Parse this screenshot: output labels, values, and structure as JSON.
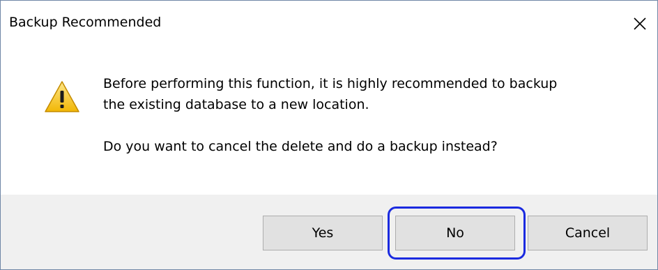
{
  "dialog": {
    "title": "Backup Recommended",
    "close_icon": "close-icon",
    "warning_icon": "warning-icon",
    "message_line1": "Before performing this function, it is highly recommended to backup",
    "message_line2": "the existing database to a new location.",
    "question": "Do you want to cancel the delete and do a backup instead?"
  },
  "buttons": {
    "yes_label": "Yes",
    "no_label": "No",
    "cancel_label": "Cancel"
  },
  "colors": {
    "highlight": "#1a2ae0",
    "footer_bg": "#f0f0f0",
    "button_bg": "#e1e1e1",
    "warning_yellow": "#f5c518"
  }
}
